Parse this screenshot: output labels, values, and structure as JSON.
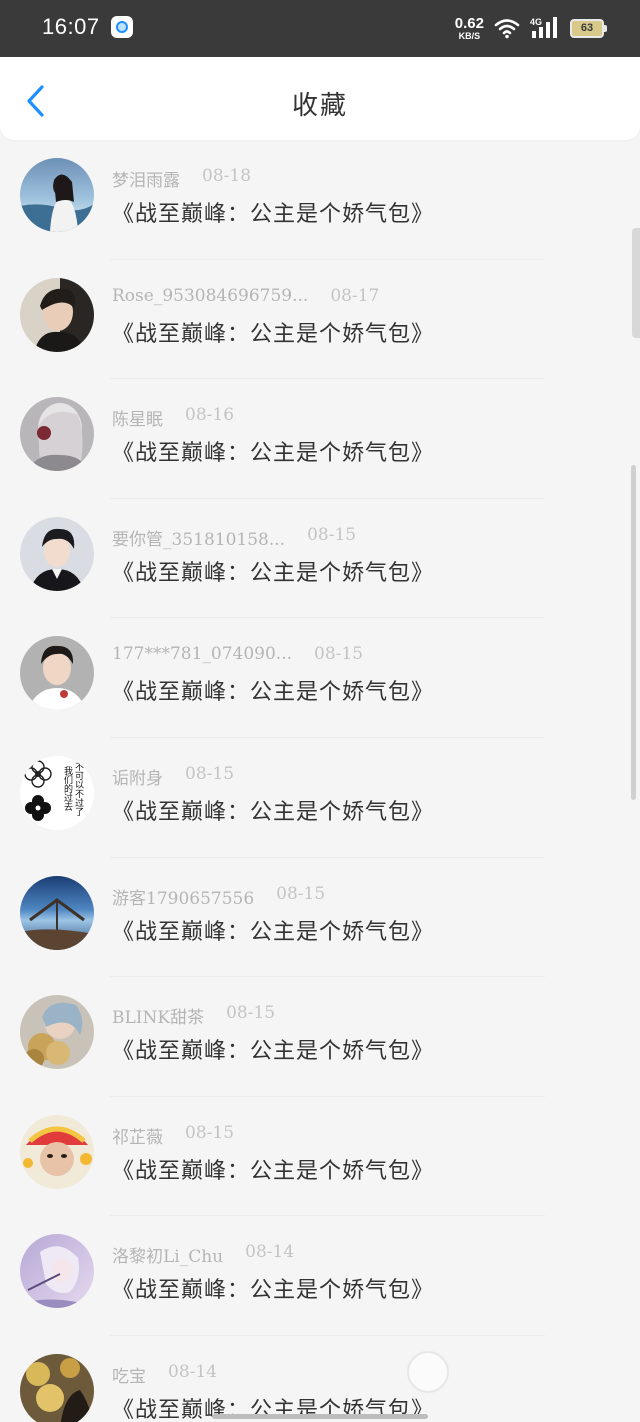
{
  "status_bar": {
    "time": "16:07",
    "net_speed_value": "0.62",
    "net_speed_unit": "KB/S",
    "network_type": "4G",
    "battery_level": "63"
  },
  "header": {
    "title": "收藏",
    "back_icon": "chevron-left-icon"
  },
  "colors": {
    "accent": "#1e90ff",
    "status_bar_bg": "#3a3a3a",
    "page_bg": "#f5f5f5",
    "title_text": "#333333",
    "meta_text": "#b5b5b5"
  },
  "items": [
    {
      "user": "梦泪雨露",
      "date": "08-18",
      "title": "《战至巅峰：公主是个娇气包》"
    },
    {
      "user": "Rose_953084696759...",
      "date": "08-17",
      "title": "《战至巅峰：公主是个娇气包》"
    },
    {
      "user": "陈星眠",
      "date": "08-16",
      "title": "《战至巅峰：公主是个娇气包》"
    },
    {
      "user": "要你管_351810158...",
      "date": "08-15",
      "title": "《战至巅峰：公主是个娇气包》"
    },
    {
      "user": "177***781_074090...",
      "date": "08-15",
      "title": "《战至巅峰：公主是个娇气包》"
    },
    {
      "user": "诟附身",
      "date": "08-15",
      "title": "《战至巅峰：公主是个娇气包》"
    },
    {
      "user": "游客1790657556",
      "date": "08-15",
      "title": "《战至巅峰：公主是个娇气包》"
    },
    {
      "user": "BLINK甜茶",
      "date": "08-15",
      "title": "《战至巅峰：公主是个娇气包》"
    },
    {
      "user": "祁芷薇",
      "date": "08-15",
      "title": "《战至巅峰：公主是个娇气包》"
    },
    {
      "user": "洛黎初Li_Chu",
      "date": "08-14",
      "title": "《战至巅峰：公主是个娇气包》"
    },
    {
      "user": "吃宝",
      "date": "08-14",
      "title": "《战至巅峰：公主是个娇气包》"
    }
  ],
  "avatar_text": {
    "line1": "不可以不过了",
    "line2": "我们的过去"
  }
}
